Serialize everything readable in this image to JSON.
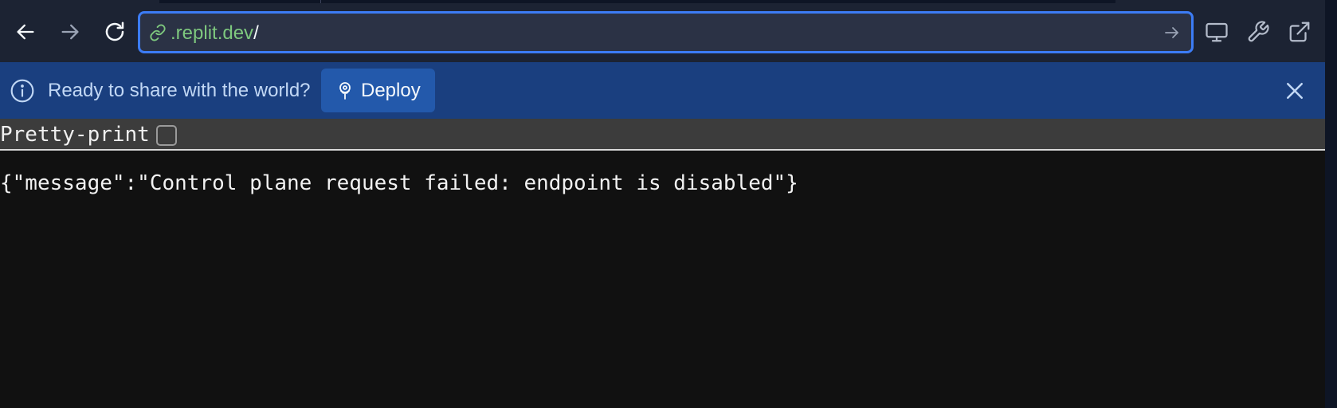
{
  "browser": {
    "url_host": ".replit.dev",
    "url_path": "/",
    "icons": {
      "back": "arrow-left-icon",
      "forward": "arrow-right-icon",
      "reload": "reload-icon",
      "link": "link-icon",
      "go": "arrow-right-icon",
      "devices": "monitor-icon",
      "devtools": "wrench-icon",
      "open_new_tab": "external-link-icon"
    },
    "colors": {
      "toolbar_bg": "#1c2333",
      "url_border": "#3c7cf5",
      "url_host": "#7ec87e"
    }
  },
  "banner": {
    "message": "Ready to share with the world?",
    "deploy_label": "Deploy",
    "icons": {
      "info": "info-icon",
      "deploy": "deploy-icon",
      "close": "close-icon"
    },
    "colors": {
      "bg": "#1a3f7f",
      "button_bg": "#2359ab"
    }
  },
  "viewer": {
    "pretty_print_label": "Pretty-print",
    "pretty_print_checked": false,
    "json_text": "{\"message\":\"Control plane request failed: endpoint is disabled\"}"
  }
}
